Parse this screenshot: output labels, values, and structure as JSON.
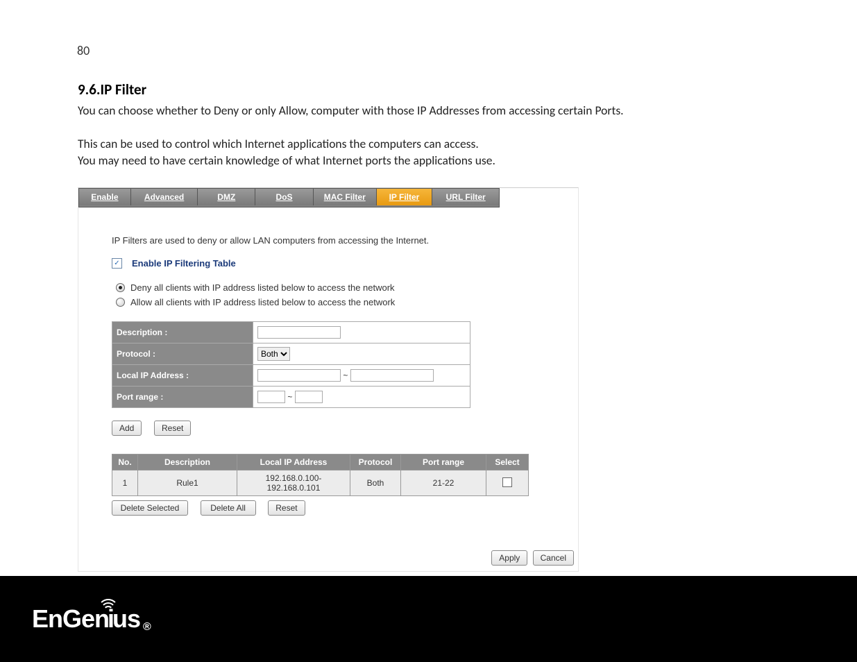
{
  "page_number": "80",
  "section_title": "9.6.IP Filter",
  "paragraphs": {
    "p1": "You can choose whether to Deny or only Allow, computer with those IP Addresses from accessing certain Ports.",
    "p2": "This can be used to control which Internet applications the computers can access.",
    "p3": "You may need to have certain knowledge of what Internet ports the applications use."
  },
  "tabs": {
    "enable": "Enable",
    "advanced": "Advanced",
    "dmz": "DMZ",
    "dos": "DoS",
    "mac_filter": "MAC Filter",
    "ip_filter": "IP Filter",
    "url_filter": "URL Filter"
  },
  "panel": {
    "desc": "IP Filters are used to deny or allow LAN computers from accessing the Internet.",
    "enable_checkbox_label": "Enable IP Filtering Table",
    "enable_checkbox_checked": true,
    "radio_deny": "Deny all clients with IP address listed below to access the network",
    "radio_allow": "Allow all clients with IP address listed below to access the network",
    "radio_selected": "deny",
    "form": {
      "description_label": "Description :",
      "description_value": "",
      "protocol_label": "Protocol :",
      "protocol_value": "Both",
      "local_ip_label": "Local IP Address :",
      "local_ip_from": "",
      "local_ip_to": "",
      "range_sep": "~",
      "port_range_label": "Port range :",
      "port_from": "",
      "port_to": ""
    },
    "buttons": {
      "add": "Add",
      "reset": "Reset",
      "delete_selected": "Delete Selected",
      "delete_all": "Delete All",
      "reset2": "Reset",
      "apply": "Apply",
      "cancel": "Cancel"
    },
    "rules_headers": {
      "no": "No.",
      "description": "Description",
      "local_ip": "Local IP Address",
      "protocol": "Protocol",
      "port_range": "Port range",
      "select": "Select"
    },
    "rules": [
      {
        "no": "1",
        "description": "Rule1",
        "local_ip": "192.168.0.100-192.168.0.101",
        "protocol": "Both",
        "port_range": "21-22",
        "selected": false
      }
    ]
  },
  "footer_brand": "EnGenius",
  "footer_reg": "®"
}
